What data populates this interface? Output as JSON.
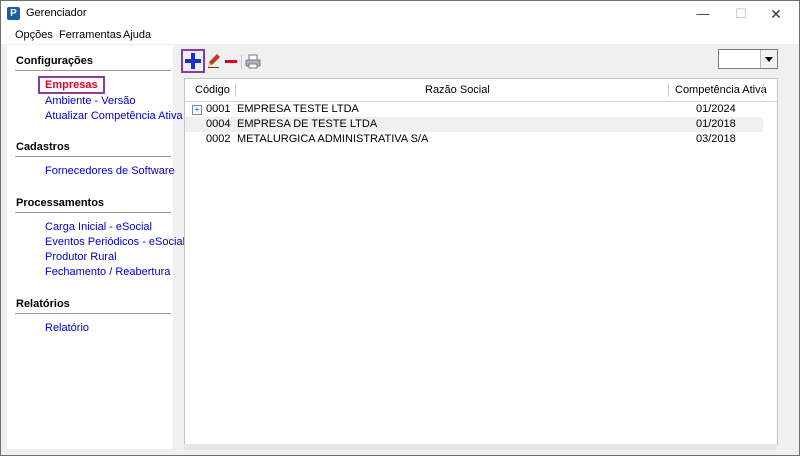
{
  "window": {
    "title": "Gerenciador",
    "controls": {
      "minimize": "—",
      "maximize": "☐",
      "close": "✕"
    }
  },
  "menu": [
    "Opções",
    "Ferramentas",
    "Ajuda"
  ],
  "sidebar": {
    "sections": [
      {
        "title": "Configurações",
        "items": [
          "Empresas",
          "Ambiente - Versão",
          "Atualizar Competência Ativa"
        ]
      },
      {
        "title": "Cadastros",
        "items": [
          "Fornecedores de Software"
        ]
      },
      {
        "title": "Processamentos",
        "items": [
          "Carga Inicial - eSocial",
          "Eventos Periódicos - eSocial",
          "Produtor Rural",
          "Fechamento / Reabertura"
        ]
      },
      {
        "title": "Relatórios",
        "items": [
          "Relatório"
        ]
      }
    ]
  },
  "toolbar": {
    "add_icon": "plus-icon",
    "edit_icon": "pencil-icon",
    "delete_icon": "minus-icon",
    "print_icon": "printer-icon",
    "combo_value": ""
  },
  "table": {
    "columns": [
      "Código",
      "Razão Social",
      "Competência Ativa"
    ],
    "rows": [
      {
        "codigo": "0001",
        "razao": "EMPRESA TESTE LTDA",
        "competencia": "01/2024"
      },
      {
        "codigo": "0004",
        "razao": "EMPRESA DE TESTE LTDA",
        "competencia": "01/2018"
      },
      {
        "codigo": "0002",
        "razao": "METALURGICA ADMINISTRATIVA S/A",
        "competencia": "03/2018"
      }
    ]
  },
  "colors": {
    "link": "#0000cc",
    "active_link": "#e0002a",
    "highlight_box": "#8a3ba3",
    "add_icon": "#1d2fc8",
    "delete_icon": "#e0001a"
  }
}
